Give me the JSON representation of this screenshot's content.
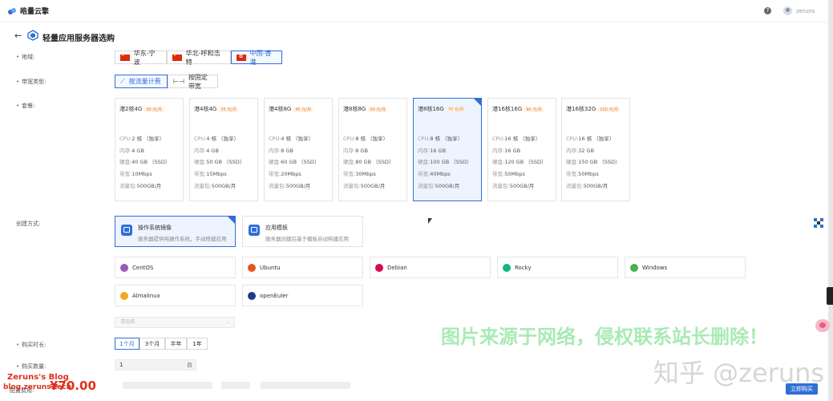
{
  "header": {
    "brand": "皓量云擎",
    "user": "zeruns"
  },
  "page": {
    "title": "轻量应用服务器选购"
  },
  "labels": {
    "region": "地域:",
    "bandwidth_type": "带宽类型:",
    "package": "套餐:",
    "create_method": "创建方式:",
    "duration": "购买时长:",
    "quantity": "购买数量:",
    "fee": "配置费用:"
  },
  "regions": [
    {
      "label": "华东-宁波",
      "selected": false
    },
    {
      "label": "华北-呼和浩特",
      "selected": false
    },
    {
      "label": "中国-香港",
      "selected": true
    }
  ],
  "bandwidth": [
    {
      "label": "按流量计费",
      "selected": true
    },
    {
      "label": "按固定带宽",
      "selected": false
    }
  ],
  "spec_keys": {
    "cpu": "CPU:",
    "mem": "内存:",
    "disk": "硬盘:",
    "bw": "带宽:",
    "traffic": "流量包:"
  },
  "packages": [
    {
      "name": "港2核4G",
      "price": "30 元/月",
      "cpu": "2 核 （独享）",
      "mem": "4 GB",
      "disk": "40 GB （SSD）",
      "bw": "10Mbps",
      "traffic": "500GB/月",
      "selected": false
    },
    {
      "name": "港4核4G",
      "price": "35 元/月",
      "cpu": "4 核 （独享）",
      "mem": "4 GB",
      "disk": "50 GB （SSD）",
      "bw": "15Mbps",
      "traffic": "500GB/月",
      "selected": false
    },
    {
      "name": "港4核8G",
      "price": "45 元/月",
      "cpu": "4 核 （独享）",
      "mem": "8 GB",
      "disk": "60 GB （SSD）",
      "bw": "20Mbps",
      "traffic": "500GB/月",
      "selected": false
    },
    {
      "name": "港8核8G",
      "price": "50 元/月",
      "cpu": "8 核 （独享）",
      "mem": "8 GB",
      "disk": "80 GB （SSD）",
      "bw": "30Mbps",
      "traffic": "500GB/月",
      "selected": false
    },
    {
      "name": "港8核16G",
      "price": "70 元/月",
      "cpu": "8 核 （独享）",
      "mem": "16 GB",
      "disk": "100 GB （SSD）",
      "bw": "40Mbps",
      "traffic": "500GB/月",
      "selected": true
    },
    {
      "name": "港16核16G",
      "price": "90 元/月",
      "cpu": "16 核 （独享）",
      "mem": "16 GB",
      "disk": "120 GB （SSD）",
      "bw": "50Mbps",
      "traffic": "500GB/月",
      "selected": false
    },
    {
      "name": "港16核32G",
      "price": "150 元/月",
      "cpu": "16 核 （独享）",
      "mem": "32 GB",
      "disk": "150 GB （SSD）",
      "bw": "50Mbps",
      "traffic": "500GB/月",
      "selected": false
    }
  ],
  "methods": [
    {
      "title": "操作系统镜像",
      "desc": "服务器提供纯操作系统，手动搭建应用",
      "selected": true
    },
    {
      "title": "应用模板",
      "desc": "服务器创建后基于模板自动构建应用",
      "selected": false
    }
  ],
  "os_list": [
    {
      "name": "CentOS",
      "color": "#9b59b6"
    },
    {
      "name": "Ubuntu",
      "color": "#e95420"
    },
    {
      "name": "Debian",
      "color": "#d70a53"
    },
    {
      "name": "Rocky",
      "color": "#10b981"
    },
    {
      "name": "Windows",
      "color": "#4caf50"
    },
    {
      "name": "Almalinux",
      "color": "#f5a623"
    },
    {
      "name": "openEuler",
      "color": "#1f3c88"
    }
  ],
  "version_select": {
    "placeholder": "请选择"
  },
  "durations": [
    {
      "label": "1个月",
      "selected": true
    },
    {
      "label": "3个月",
      "selected": false
    },
    {
      "label": "半年",
      "selected": false
    },
    {
      "label": "1年",
      "selected": false
    }
  ],
  "quantity": {
    "value": "1",
    "unit": "台"
  },
  "price": {
    "value": "¥70.00"
  },
  "buy_label": "立即购买",
  "watermarks": {
    "notice": "图片来源于网络，侵权联系站长删除！",
    "zhihu": "知乎 @zeruns",
    "blog_title": "Zeruns's Blog",
    "blog_url": "blog.zeruns.tech"
  },
  "colors": {
    "accent": "#2f6fd6",
    "price": "#e0301e"
  }
}
